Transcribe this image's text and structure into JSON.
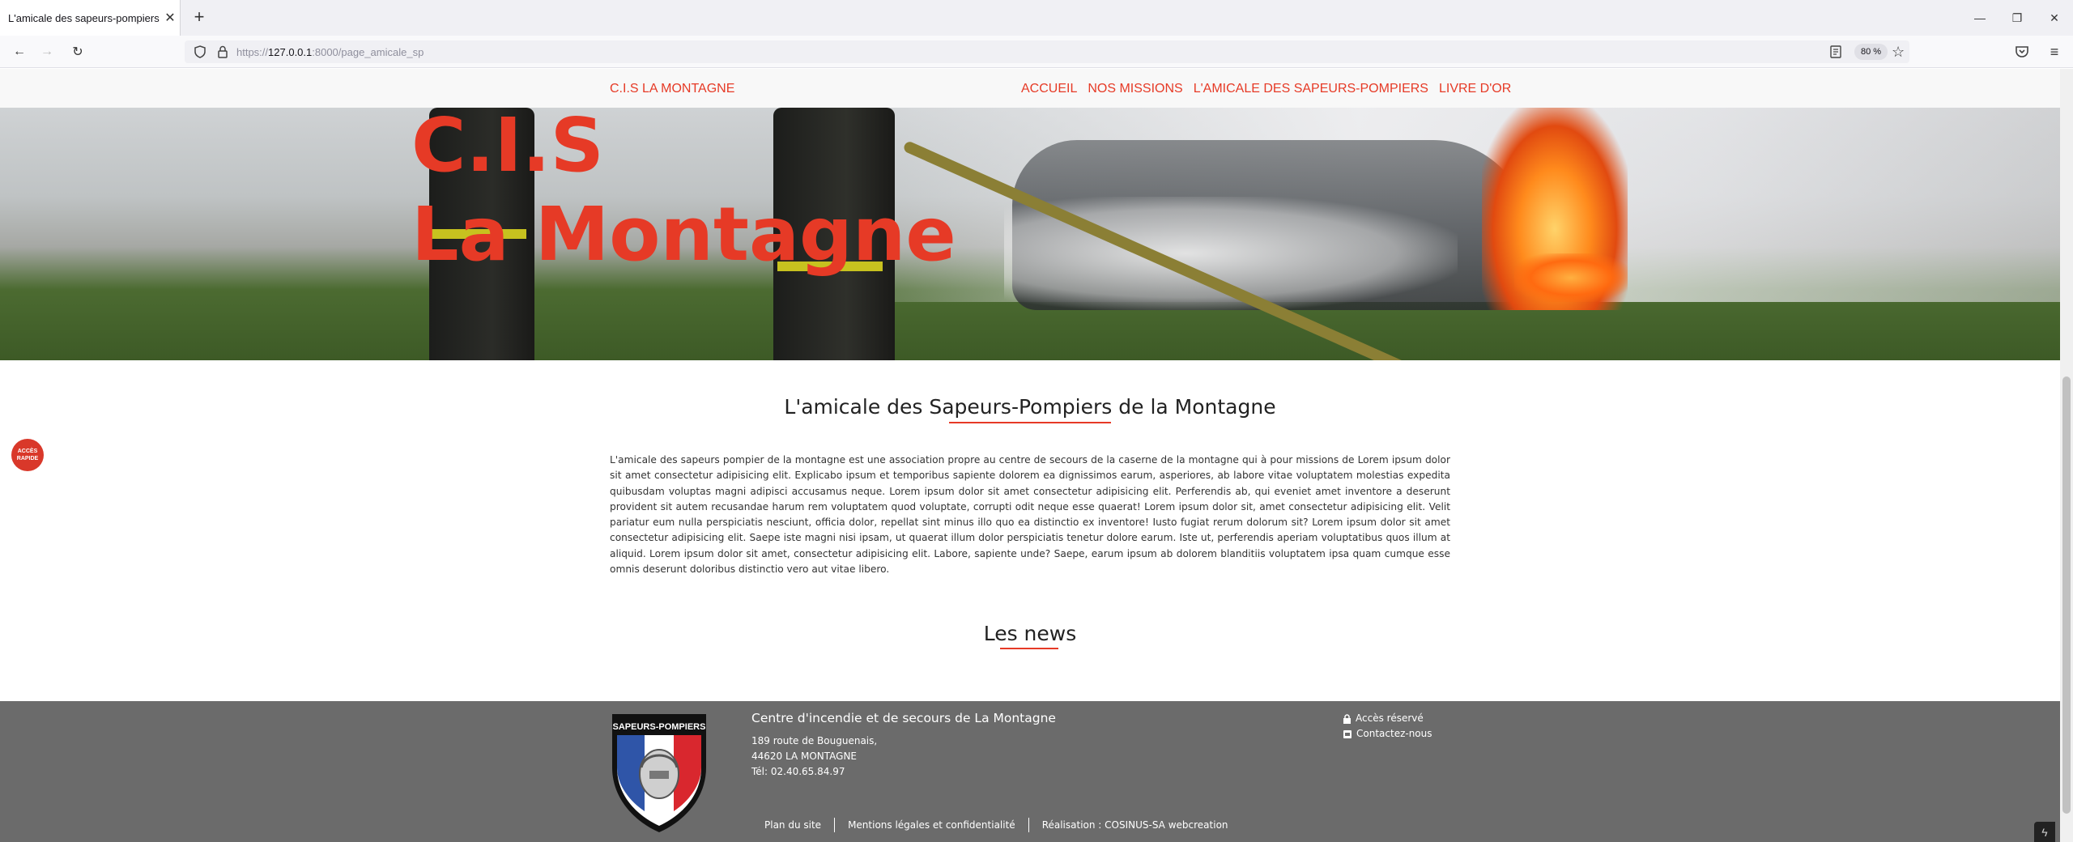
{
  "browser": {
    "tab_title": "L'amicale des sapeurs-pompiers",
    "tab_close": "✕",
    "new_tab": "+",
    "url_scheme": "https://",
    "url_host": "127.0.0.1",
    "url_rest": ":8000/page_amicale_sp",
    "zoom": "80 %",
    "back": "←",
    "forward": "→",
    "reload": "↻",
    "minimize": "—",
    "restore": "❐",
    "close": "✕",
    "menu": "≡",
    "star": "☆"
  },
  "site_nav": {
    "brand": "C.I.S LA MONTAGNE",
    "items": [
      "ACCUEIL",
      "NOS MISSIONS",
      "L'AMICALE DES SAPEURS-POMPIERS",
      "LIVRE D'OR"
    ]
  },
  "hero": {
    "line1": "C.I.S",
    "line2": "La Montagne"
  },
  "quick_access": {
    "line1": "ACCÈS",
    "line2": "RAPIDE"
  },
  "section": {
    "title": "L'amicale des Sapeurs-Pompiers de la Montagne",
    "intro": "L'amicale des sapeurs pompier de la montagne est une association propre au centre de secours de la caserne de la montagne qui à pour missions de Lorem ipsum dolor sit amet consectetur adipisicing elit. Explicabo ipsum et temporibus sapiente dolorem ea dignissimos earum, asperiores, ab labore vitae voluptatem molestias expedita quibusdam voluptas magni adipisci accusamus neque. Lorem ipsum dolor sit amet consectetur adipisicing elit. Perferendis ab, qui eveniet amet inventore a deserunt provident sit autem recusandae harum rem voluptatem quod voluptate, corrupti odit neque esse quaerat! Lorem ipsum dolor sit, amet consectetur adipisicing elit. Velit pariatur eum nulla perspiciatis nesciunt, officia dolor, repellat sint minus illo quo ea distinctio ex inventore! Iusto fugiat rerum dolorum sit? Lorem ipsum dolor sit amet consectetur adipisicing elit. Saepe iste magni nisi ipsam, ut quaerat illum dolor perspiciatis tenetur dolore earum. Iste ut, perferendis aperiam voluptatibus quos illum at aliquid. Lorem ipsum dolor sit amet, consectetur adipisicing elit. Labore, sapiente unde? Saepe, earum ipsum ab dolorem blanditiis voluptatem ipsa quam cumque esse omnis deserunt doloribus distinctio vero aut vitae libero.",
    "news_title": "Les news"
  },
  "footer": {
    "crest_text": "SAPEURS-POMPIERS",
    "title": "Centre d'incendie et de secours de La Montagne",
    "address_line1": "189 route de Bouguenais,",
    "address_line2": "44620 LA MONTAGNE",
    "phone": "Tél: 02.40.65.84.97",
    "reserved": "Accès réservé",
    "contact": "Contactez-nous",
    "links": [
      "Plan du site",
      "Mentions légales et confidentialité",
      "Réalisation : COSINUS-SA webcreation"
    ]
  },
  "colors": {
    "accent": "#e63a26",
    "footer_bg": "#6b6b6b"
  }
}
